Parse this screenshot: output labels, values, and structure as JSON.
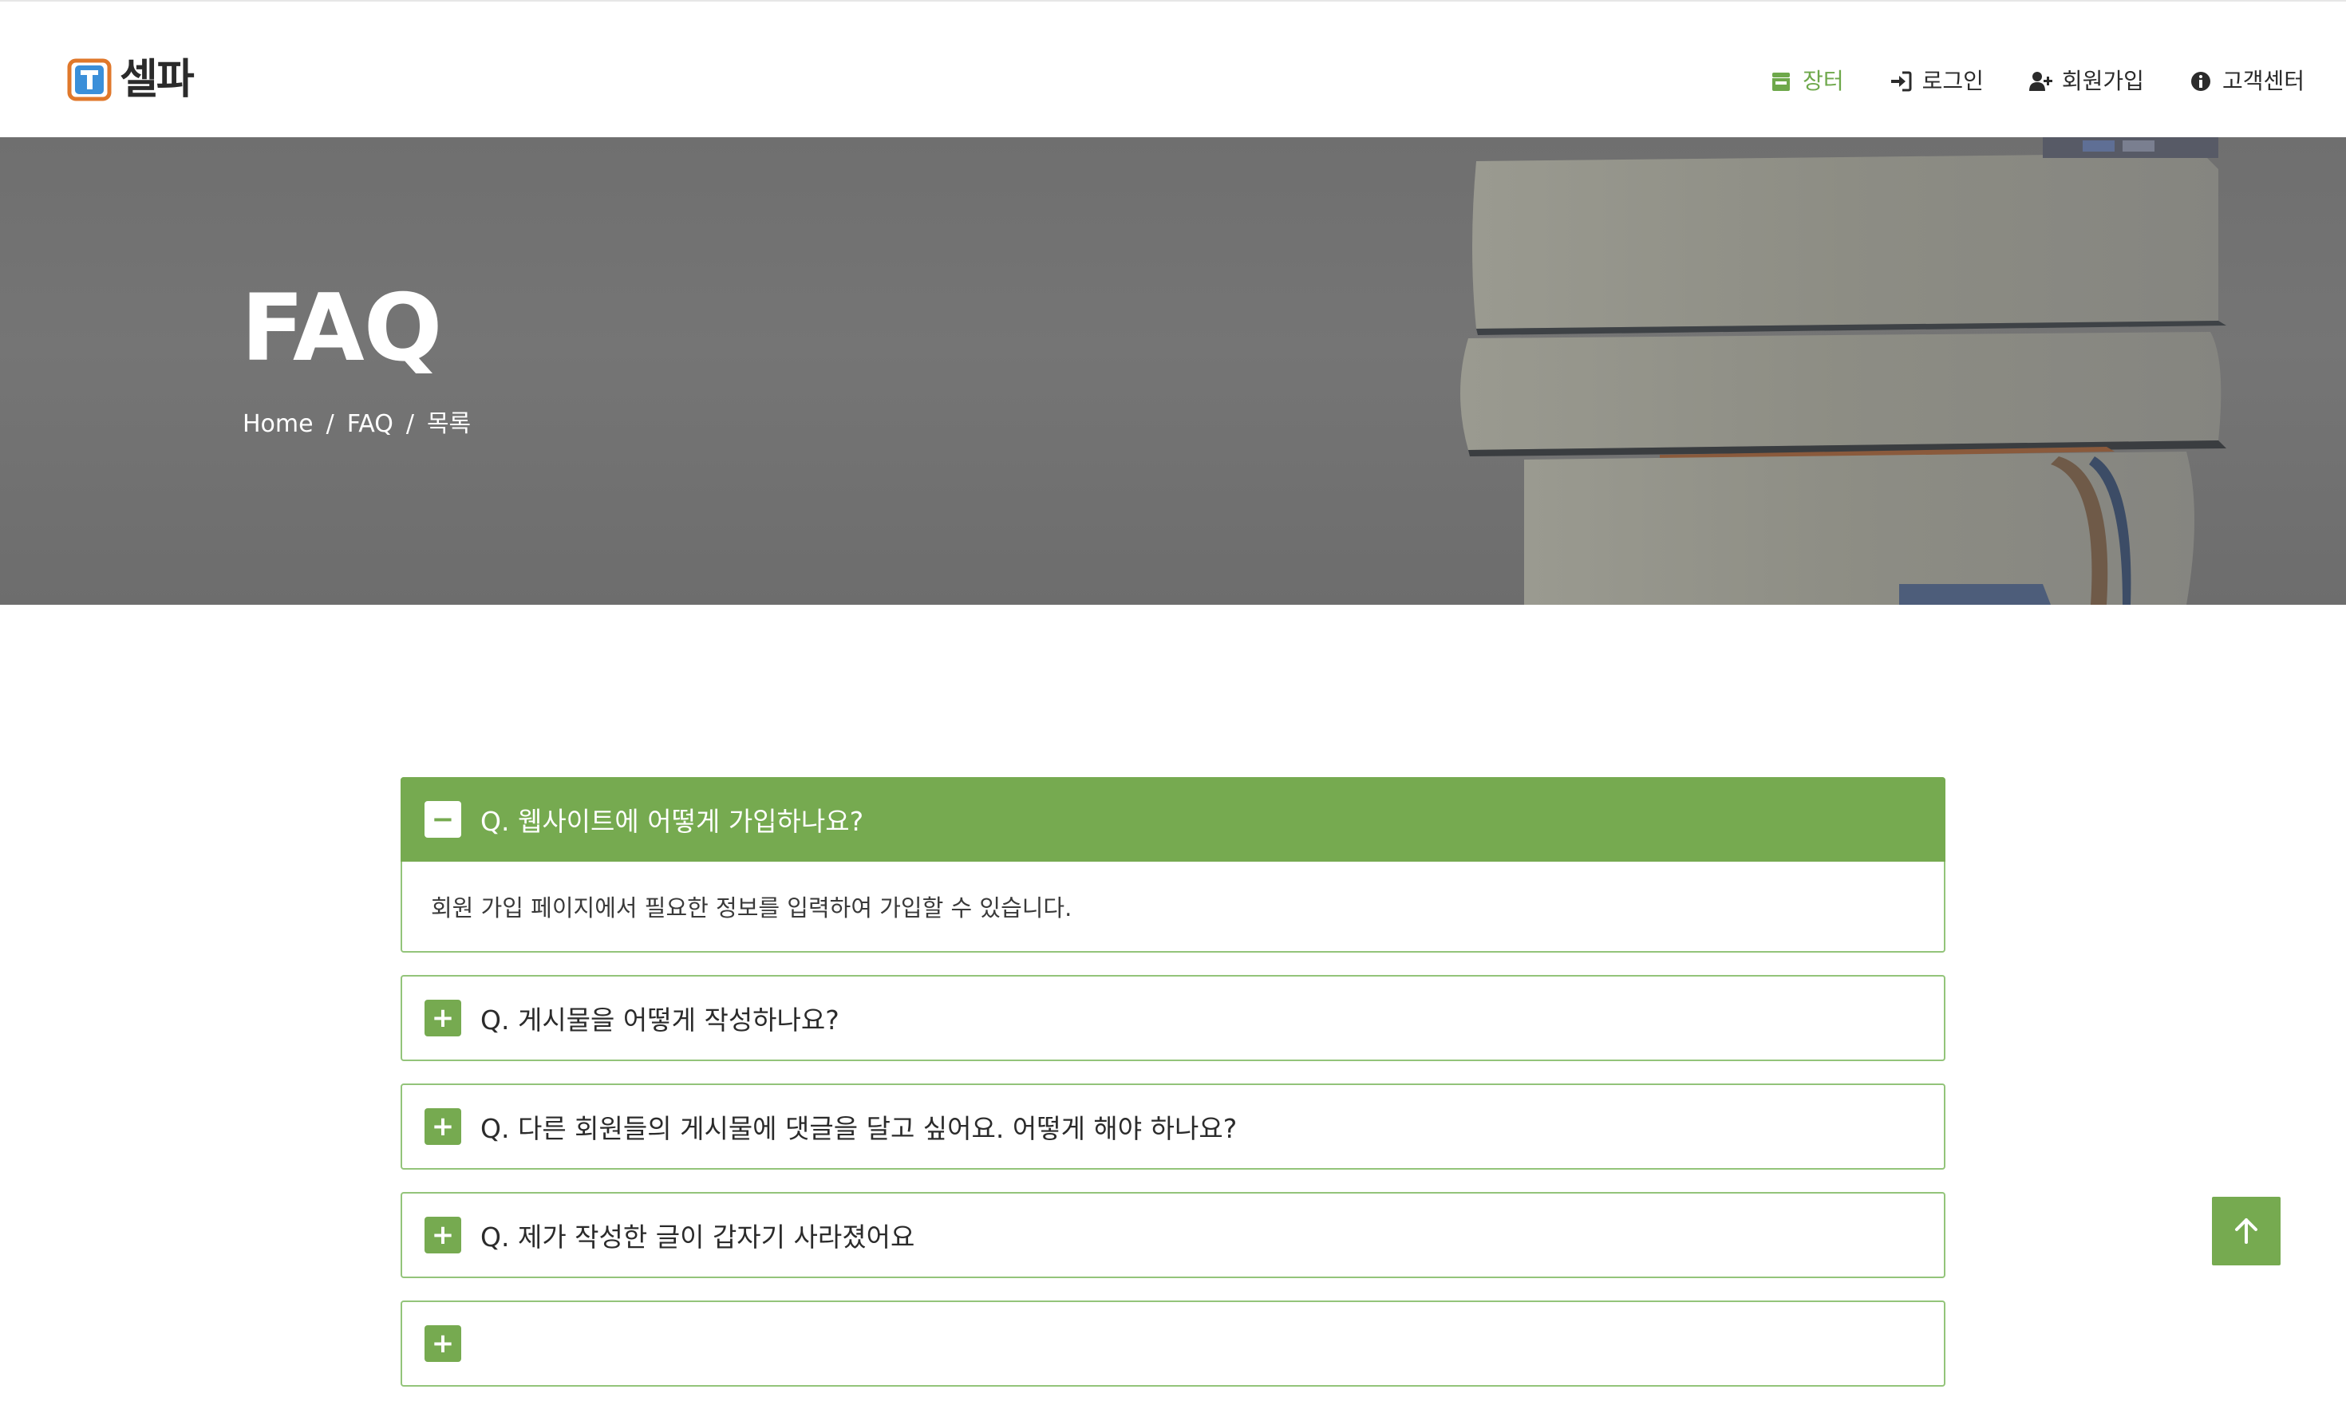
{
  "brand": {
    "name": "셀파",
    "accent": "#76aa50",
    "logo_orange": "#e0782b",
    "logo_blue": "#3b8fd9"
  },
  "nav": {
    "items": [
      {
        "label": "장터",
        "icon": "store-icon",
        "active": true
      },
      {
        "label": "로그인",
        "icon": "sign-in-icon",
        "active": false
      },
      {
        "label": "회원가입",
        "icon": "user-plus-icon",
        "active": false
      },
      {
        "label": "고객센터",
        "icon": "info-circle-icon",
        "active": false
      }
    ]
  },
  "hero": {
    "title": "FAQ",
    "breadcrumb": [
      "Home",
      "FAQ",
      "목록"
    ],
    "separator": "/"
  },
  "faq": {
    "items": [
      {
        "question": "Q. 웹사이트에 어떻게 가입하나요?",
        "answer": "회원 가입 페이지에서 필요한 정보를 입력하여 가입할 수 있습니다.",
        "open": true,
        "toggle": "−"
      },
      {
        "question": "Q. 게시물을 어떻게 작성하나요?",
        "open": false,
        "toggle": "+"
      },
      {
        "question": "Q. 다른 회원들의 게시물에 댓글을 달고 싶어요. 어떻게 해야 하나요?",
        "open": false,
        "toggle": "+"
      },
      {
        "question": "Q. 제가 작성한 글이 갑자기 사라졌어요",
        "open": false,
        "toggle": "+"
      },
      {
        "question": "",
        "open": false,
        "toggle": "+"
      }
    ]
  },
  "back_to_top": {
    "icon": "arrow-up-icon"
  }
}
